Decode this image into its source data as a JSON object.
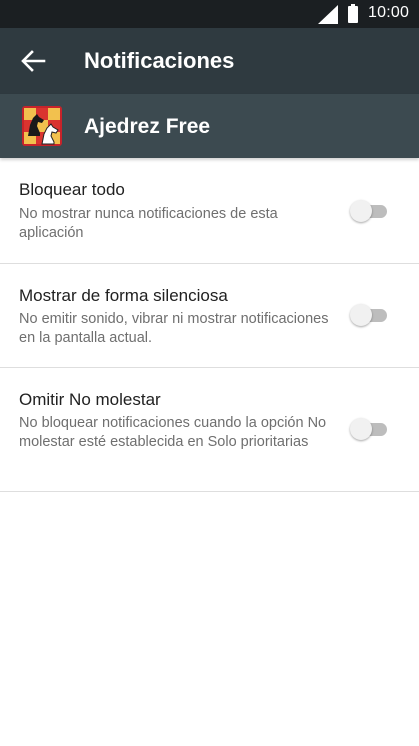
{
  "status_bar": {
    "time": "10:00",
    "icons": [
      "signal-icon",
      "battery-icon"
    ]
  },
  "toolbar": {
    "back_icon": "arrow-left-icon",
    "title": "Notificaciones"
  },
  "app": {
    "icon": "chess-knight-icon",
    "name": "Ajedrez Free"
  },
  "settings": [
    {
      "title": "Bloquear todo",
      "description": "No mostrar nunca notificaciones de esta aplicación",
      "enabled": false
    },
    {
      "title": "Mostrar de forma silenciosa",
      "description": "No emitir sonido, vibrar ni mostrar notificaciones en la pantalla actual.",
      "enabled": false
    },
    {
      "title": "Omitir No molestar",
      "description": "No bloquear notificaciones cuando la opción No molestar esté establecida en Solo prioritarias",
      "enabled": false
    }
  ],
  "colors": {
    "toolbar": "#2f3a40",
    "app_header": "#3c4a50",
    "status_bar": "#1b1f22",
    "toggle_track_off": "#bdbdbd",
    "toggle_thumb_off": "#f1f1f1"
  }
}
